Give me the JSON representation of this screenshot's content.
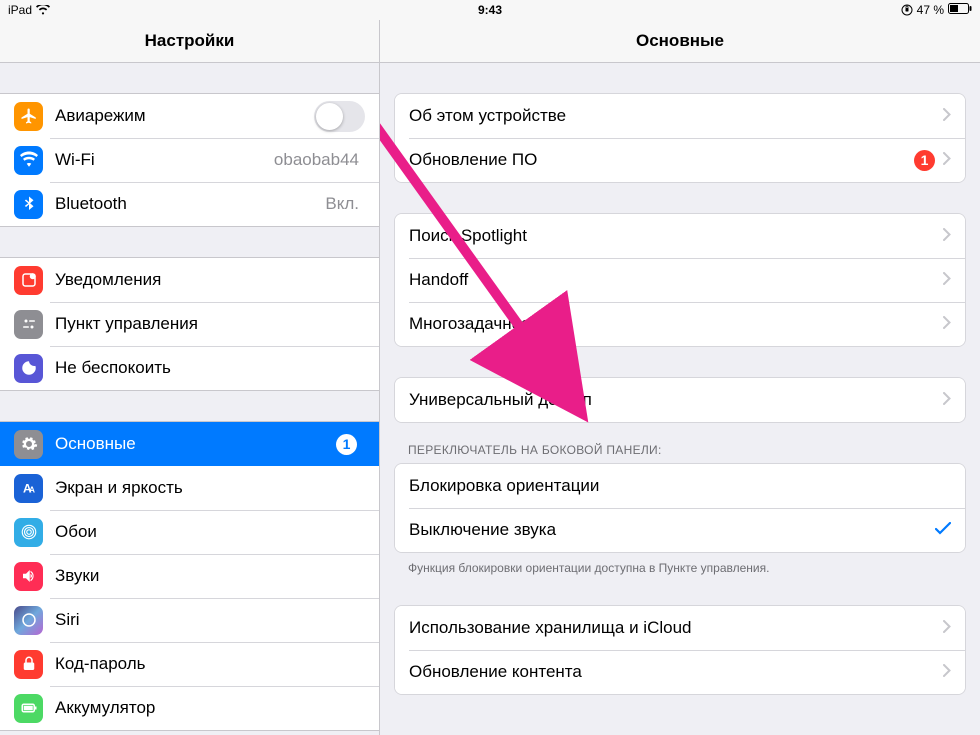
{
  "status": {
    "device": "iPad",
    "time": "9:43",
    "battery": "47 %"
  },
  "sidebar": {
    "title": "Настройки",
    "groups": [
      {
        "id": "g1",
        "rows": [
          {
            "id": "airplane",
            "label": "Авиарежим",
            "type": "toggle",
            "iconColor": "ic-orange"
          },
          {
            "id": "wifi",
            "label": "Wi-Fi",
            "value": "obaobab44",
            "type": "link",
            "iconColor": "ic-blue"
          },
          {
            "id": "bluetooth",
            "label": "Bluetooth",
            "value": "Вкл.",
            "type": "link",
            "iconColor": "ic-blue"
          }
        ]
      },
      {
        "id": "g2",
        "rows": [
          {
            "id": "notifications",
            "label": "Уведомления",
            "type": "link",
            "iconColor": "ic-red"
          },
          {
            "id": "controlcenter",
            "label": "Пункт управления",
            "type": "link",
            "iconColor": "ic-gray"
          },
          {
            "id": "dnd",
            "label": "Не беспокоить",
            "type": "link",
            "iconColor": "ic-moon"
          }
        ]
      },
      {
        "id": "g3",
        "rows": [
          {
            "id": "general",
            "label": "Основные",
            "type": "link",
            "selected": true,
            "badge": "1",
            "iconColor": "ic-gray"
          },
          {
            "id": "display",
            "label": "Экран и яркость",
            "type": "link",
            "iconColor": "ic-darkblue"
          },
          {
            "id": "wallpaper",
            "label": "Обои",
            "type": "link",
            "iconColor": "ic-teal"
          },
          {
            "id": "sounds",
            "label": "Звуки",
            "type": "link",
            "iconColor": "ic-pink"
          },
          {
            "id": "siri",
            "label": "Siri",
            "type": "link",
            "iconColor": "ic-siri"
          },
          {
            "id": "passcode",
            "label": "Код-пароль",
            "type": "link",
            "iconColor": "ic-red"
          },
          {
            "id": "battery",
            "label": "Аккумулятор",
            "type": "link",
            "iconColor": "ic-green"
          }
        ]
      }
    ]
  },
  "detail": {
    "title": "Основные",
    "sections": [
      {
        "rows": [
          {
            "id": "about",
            "label": "Об этом устройстве"
          },
          {
            "id": "swupdate",
            "label": "Обновление ПО",
            "badge": "1"
          }
        ]
      },
      {
        "rows": [
          {
            "id": "spotlight",
            "label": "Поиск Spotlight"
          },
          {
            "id": "handoff",
            "label": "Handoff"
          },
          {
            "id": "multitask",
            "label": "Многозадачность"
          }
        ]
      },
      {
        "rows": [
          {
            "id": "accessibility",
            "label": "Универсальный доступ"
          }
        ]
      },
      {
        "header": "ПЕРЕКЛЮЧАТЕЛЬ НА БОКОВОЙ ПАНЕЛИ:",
        "footer": "Функция блокировки ориентации доступна в Пункте управления.",
        "rows": [
          {
            "id": "lockrot",
            "label": "Блокировка ориентации",
            "type": "check",
            "checked": false
          },
          {
            "id": "mute",
            "label": "Выключение звука",
            "type": "check",
            "checked": true
          }
        ]
      },
      {
        "rows": [
          {
            "id": "storage",
            "label": "Использование хранилища и iCloud"
          },
          {
            "id": "bgrefresh",
            "label": "Обновление контента"
          }
        ]
      }
    ]
  }
}
